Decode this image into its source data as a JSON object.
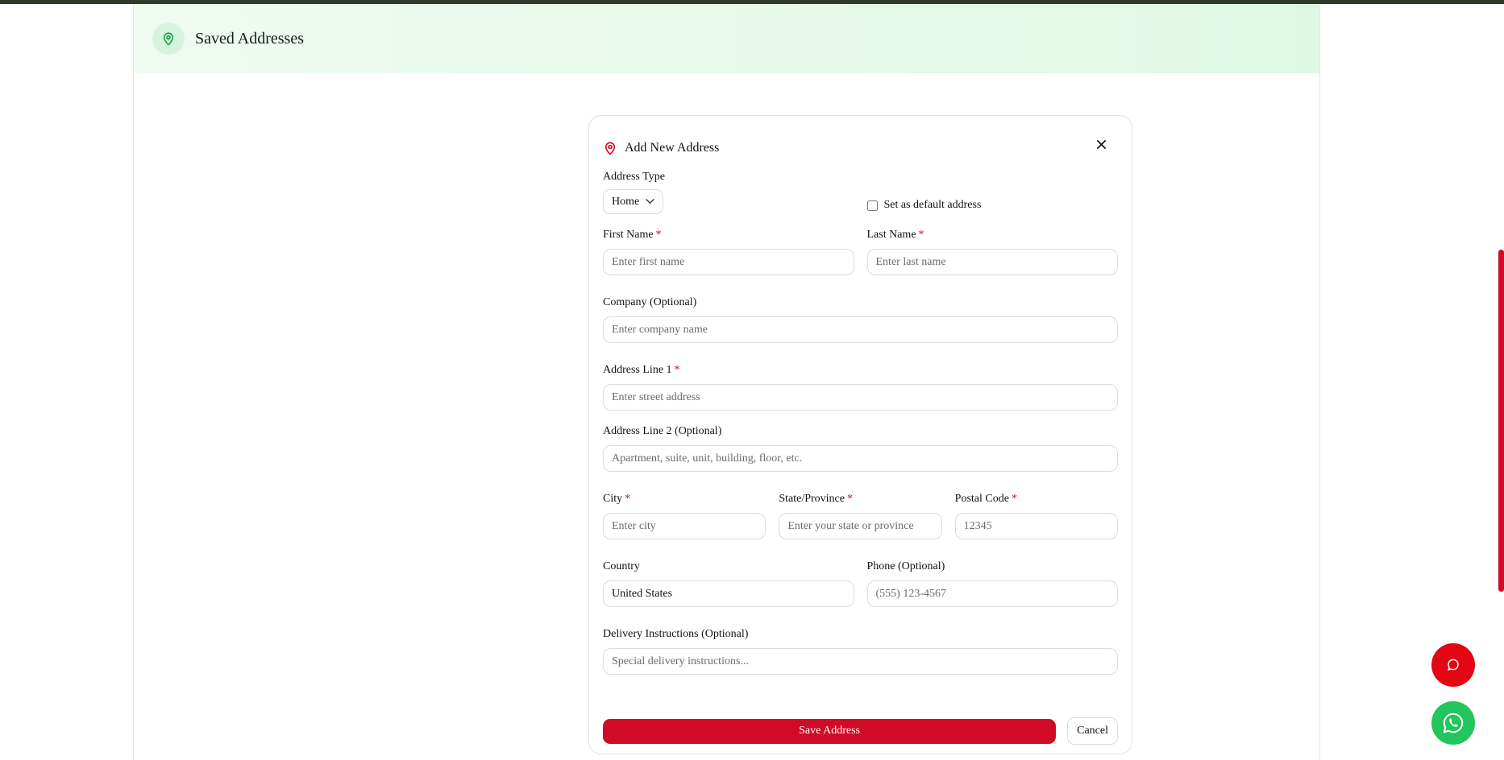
{
  "header": {
    "title": "Saved Addresses",
    "icon": "map-pin-icon"
  },
  "modal": {
    "title": "Add New Address",
    "icon": "map-pin-icon",
    "close_icon": "close-icon",
    "address_type": {
      "label": "Address Type",
      "selected": "Home"
    },
    "default_checkbox": {
      "label": "Set as default address",
      "checked": false
    },
    "first_name": {
      "label": "First Name",
      "placeholder": "Enter first name",
      "required_mark": "*"
    },
    "last_name": {
      "label": "Last Name",
      "placeholder": "Enter last name",
      "required_mark": "*"
    },
    "company": {
      "label": "Company (Optional)",
      "placeholder": "Enter company name"
    },
    "address1": {
      "label": "Address Line 1",
      "placeholder": "Enter street address",
      "required_mark": "*"
    },
    "address2": {
      "label": "Address Line 2 (Optional)",
      "placeholder": "Apartment, suite, unit, building, floor, etc."
    },
    "city": {
      "label": "City",
      "placeholder": "Enter city",
      "required_mark": "*"
    },
    "state": {
      "label": "State/Province",
      "placeholder": "Enter your state or province",
      "required_mark": "*"
    },
    "postal": {
      "label": "Postal Code",
      "placeholder": "12345",
      "required_mark": "*"
    },
    "country": {
      "label": "Country",
      "value": "United States"
    },
    "phone": {
      "label": "Phone (Optional)",
      "placeholder": "(555) 123-4567"
    },
    "instructions": {
      "label": "Delivery Instructions (Optional)",
      "placeholder": "Special delivery instructions..."
    },
    "save_label": "Save Address",
    "cancel_label": "Cancel"
  },
  "floating": {
    "chat_icon": "chat-bubble-icon",
    "whatsapp_icon": "whatsapp-icon"
  },
  "colors": {
    "accent_red": "#d10a26",
    "header_green": "#dff8e6",
    "whatsapp_green": "#22c55e"
  }
}
